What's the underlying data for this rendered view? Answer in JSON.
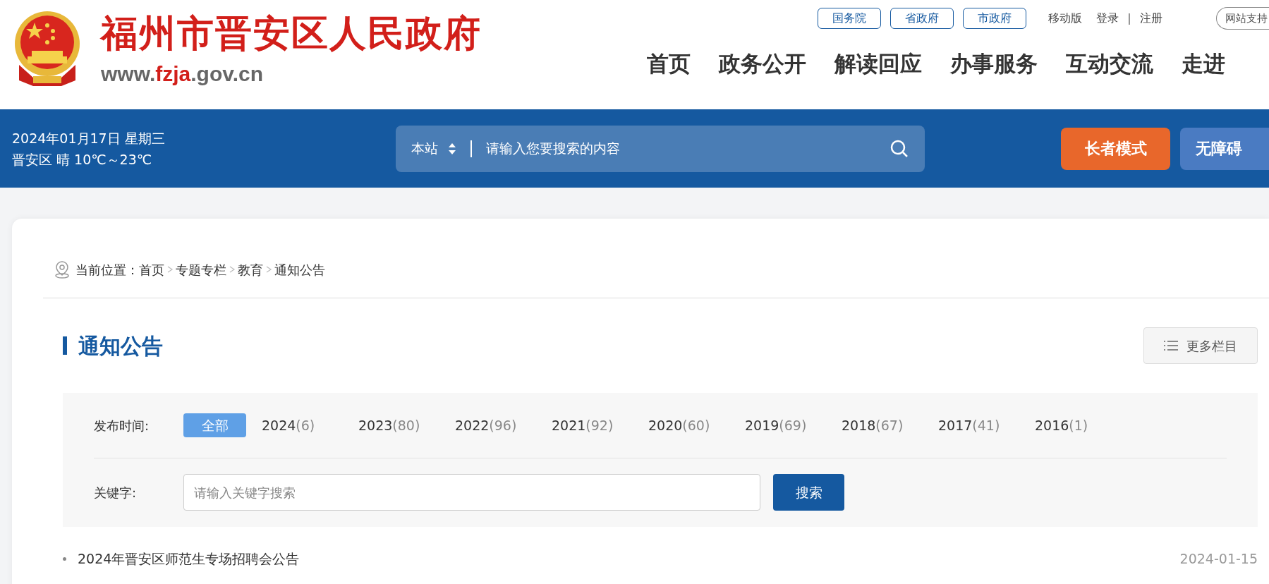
{
  "header": {
    "site_title": "福州市晋安区人民政府",
    "url": {
      "prefix": "www.",
      "highlight": "fzja",
      "suffix": ".gov.cn"
    },
    "gov_links": [
      "国务院",
      "省政府",
      "市政府"
    ],
    "top_links": [
      {
        "kind": "link",
        "label": "移动版"
      },
      {
        "kind": "link",
        "label": "登录"
      },
      {
        "kind": "separator",
        "label": "|"
      },
      {
        "kind": "link",
        "label": "注册"
      },
      {
        "kind": "pill",
        "label": "网站支持"
      }
    ],
    "nav": [
      "首页",
      "政务公开",
      "解读回应",
      "办事服务",
      "互动交流",
      "走进"
    ]
  },
  "info_bar": {
    "date": "2024年01月17日 星期三",
    "weather": "晋安区 晴 10℃～23℃",
    "search": {
      "scope": "本站",
      "placeholder": "请输入您要搜索的内容"
    },
    "mode_buttons": [
      {
        "kind": "elder",
        "label": "长者模式"
      },
      {
        "kind": "accessible",
        "label": "无障碍"
      }
    ]
  },
  "breadcrumb": {
    "label": "当前位置：",
    "items": [
      "首页",
      "专题专栏",
      "教育",
      "通知公告"
    ]
  },
  "section": {
    "title": "通知公告",
    "more_button": "更多栏目"
  },
  "filter": {
    "time_label": "发布时间:",
    "years": [
      {
        "year": "全部",
        "selected": true
      },
      {
        "year": "2024",
        "count": "(6)",
        "selected": false
      },
      {
        "year": "2023",
        "count": "(80)",
        "selected": false
      },
      {
        "year": "2022",
        "count": "(96)",
        "selected": false
      },
      {
        "year": "2021",
        "count": "(92)",
        "selected": false
      },
      {
        "year": "2020",
        "count": "(60)",
        "selected": false
      },
      {
        "year": "2019",
        "count": "(69)",
        "selected": false
      },
      {
        "year": "2018",
        "count": "(67)",
        "selected": false
      },
      {
        "year": "2017",
        "count": "(41)",
        "selected": false
      },
      {
        "year": "2016",
        "count": "(1)",
        "selected": false
      }
    ],
    "keyword_label": "关键字:",
    "keyword_placeholder": "请输入关键字搜索",
    "search_button": "搜索"
  },
  "articles": [
    {
      "title": "2024年晋安区师范生专场招聘会公告",
      "date": "2024-01-15"
    }
  ]
}
